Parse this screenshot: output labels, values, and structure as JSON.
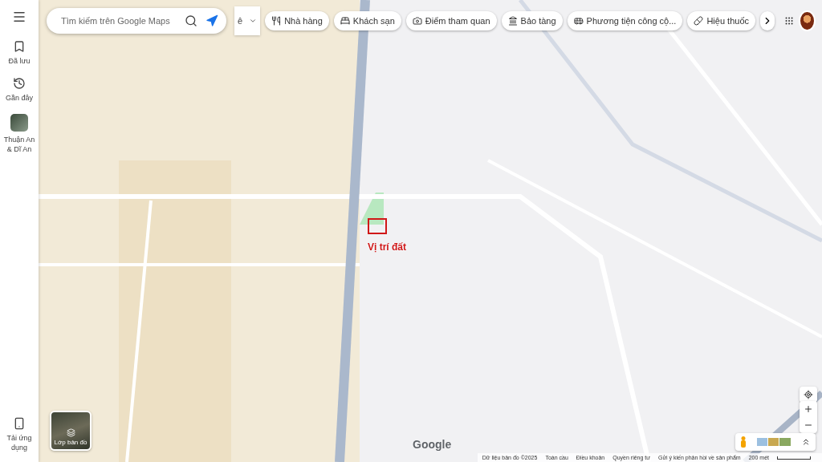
{
  "sidebar": {
    "items": [
      {
        "label": "Đã lưu",
        "kind": "saved"
      },
      {
        "label": "Gần đây",
        "kind": "recent"
      },
      {
        "label": "Thuận An & Dĩ An",
        "kind": "place"
      }
    ],
    "footer": {
      "label": "Tải ứng dụng"
    }
  },
  "search": {
    "placeholder": "Tìm kiếm trên Google Maps"
  },
  "input_tool": {
    "label": "ê"
  },
  "chips": [
    {
      "label": "Nhà hàng"
    },
    {
      "label": "Khách sạn"
    },
    {
      "label": "Điểm tham quan"
    },
    {
      "label": "Bảo tàng"
    },
    {
      "label": "Phương tiện công cộ..."
    },
    {
      "label": "Hiệu thuốc"
    }
  ],
  "annotation": {
    "label": "Vị trí đất"
  },
  "layers": {
    "label": "Lớp bản đồ"
  },
  "logo": "Google",
  "footer": [
    "Dữ liệu bản đồ ©2025",
    "Toàn cầu",
    "Điều khoản",
    "Quyền riêng tư",
    "Gửi ý kiến phản hồi về sản phẩm"
  ],
  "scale": {
    "label": "200 mét"
  }
}
